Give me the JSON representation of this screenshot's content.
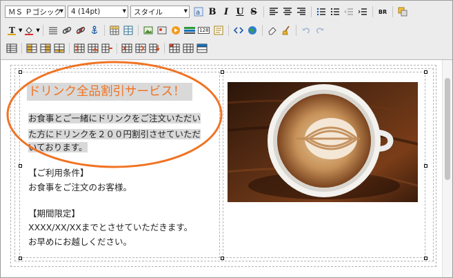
{
  "toolbar": {
    "font_family": "ＭＳ Ｐゴシック",
    "font_size": "4 (14pt)",
    "style": "スタイル",
    "bold_label": "B",
    "italic_label": "I",
    "underline_label": "U",
    "strike_label": "S",
    "br_label": "BR",
    "table_label": "128"
  },
  "content": {
    "title": "ドリンク全品割引サービス！",
    "intro_lines": [
      "お食事とご一緒にドリンクをご注文いただい",
      "た方にドリンクを２００円割引させていただ",
      "いております。"
    ],
    "conditions_heading": "【ご利用条件】",
    "conditions_text": "お食事をご注文のお客様。",
    "period_heading": "【期間限定】",
    "period_text": "XXXX/XX/XXまでとさせていただきます。",
    "closing_text": "お早めにお越しください。"
  },
  "image": {
    "subject": "latte art coffee cup on wooden table"
  },
  "colors": {
    "title": "#f07323",
    "ellipse": "#f07323",
    "highlight": "#d9d9d9"
  }
}
